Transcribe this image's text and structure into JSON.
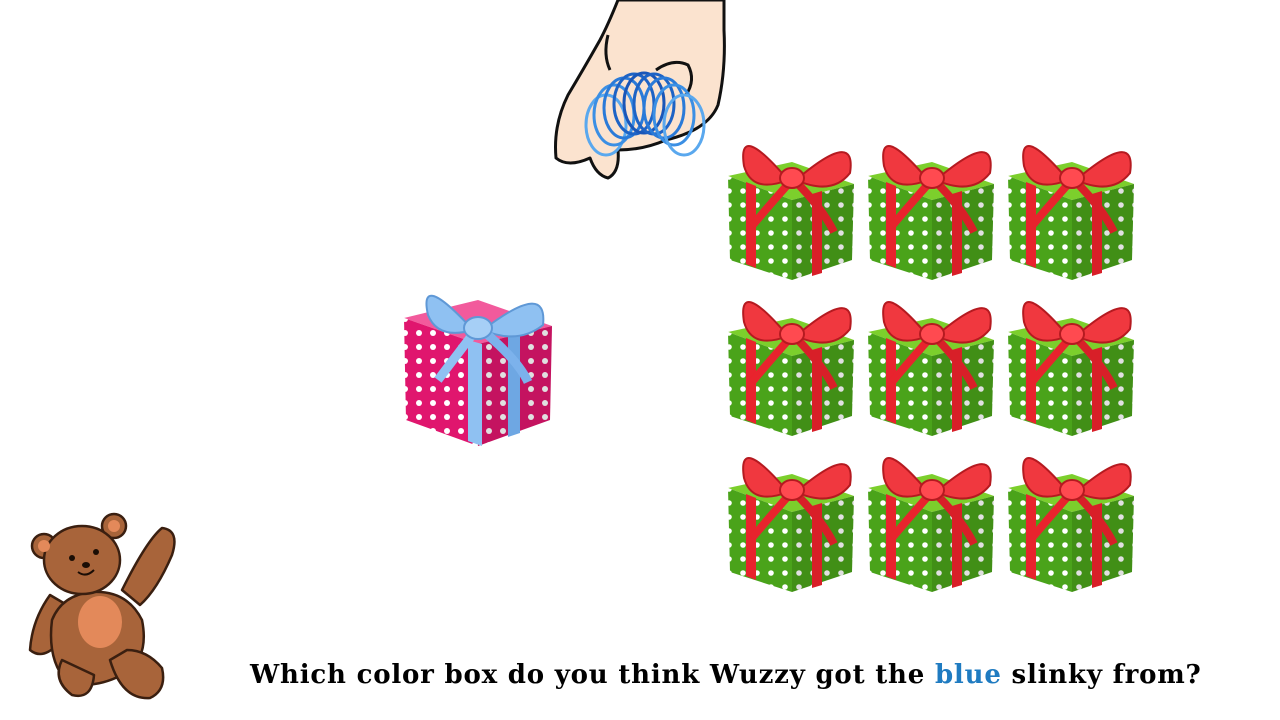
{
  "question": {
    "before": "Which color box do you think Wuzzy got the",
    "highlight": "blue",
    "after": "slinky from?"
  },
  "colors": {
    "highlight_text": "#1f7bc1",
    "pink_box": "#e0166e",
    "blue_ribbon": "#7db3ee",
    "green_box": "#4aa31a",
    "red_ribbon": "#e8232d",
    "slinky": "#2a86e3",
    "bear": "#a8643a"
  },
  "scene": {
    "pink_gift_icon": "pink-gift-box-icon",
    "green_gift_icon": "green-gift-box-icon",
    "green_gift_count": 9,
    "hand_icon": "hand-holding-slinky-icon",
    "bear_icon": "teddy-bear-icon"
  }
}
